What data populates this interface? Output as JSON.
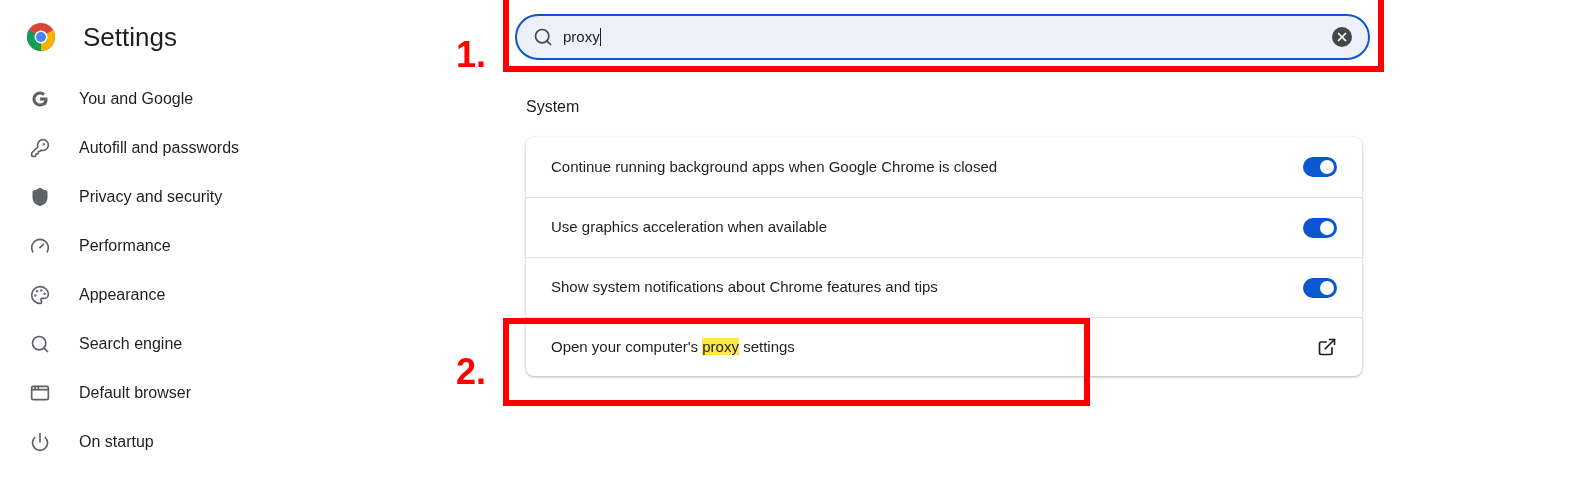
{
  "header": {
    "title": "Settings"
  },
  "sidebar": {
    "items": [
      {
        "label": "You and Google"
      },
      {
        "label": "Autofill and passwords"
      },
      {
        "label": "Privacy and security"
      },
      {
        "label": "Performance"
      },
      {
        "label": "Appearance"
      },
      {
        "label": "Search engine"
      },
      {
        "label": "Default browser"
      },
      {
        "label": "On startup"
      }
    ]
  },
  "search": {
    "value": "proxy"
  },
  "section": {
    "title": "System",
    "rows": [
      {
        "kind": "toggle",
        "label": "Continue running background apps when Google Chrome is closed",
        "on": true
      },
      {
        "kind": "toggle",
        "label": "Use graphics acceleration when available",
        "on": true
      },
      {
        "kind": "toggle",
        "label": "Show system notifications about Chrome features and tips",
        "on": true
      },
      {
        "kind": "link",
        "label_before": "Open your computer's ",
        "highlight": "proxy",
        "label_after": " settings"
      }
    ]
  },
  "annotations": [
    {
      "label": "1."
    },
    {
      "label": "2."
    }
  ]
}
